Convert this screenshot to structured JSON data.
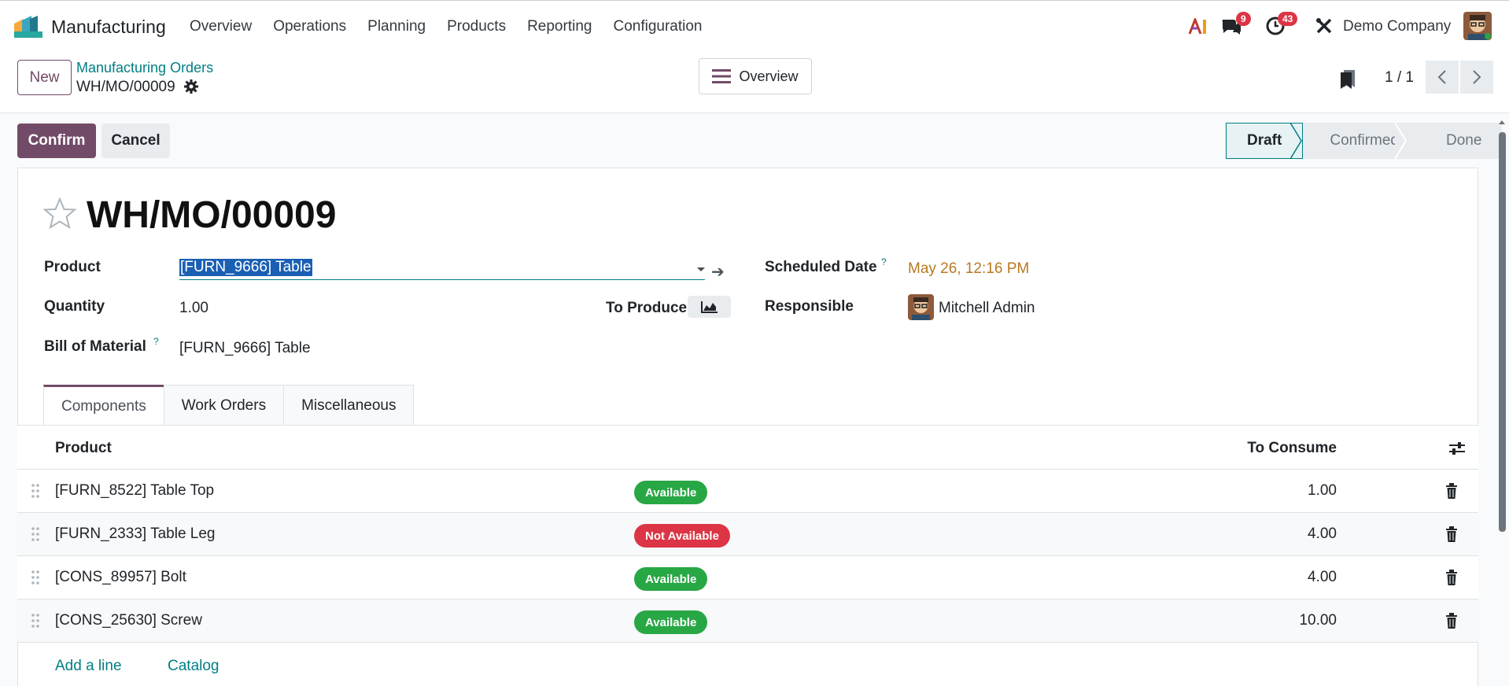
{
  "navbar": {
    "app_name": "Manufacturing",
    "menu": [
      "Overview",
      "Operations",
      "Planning",
      "Products",
      "Reporting",
      "Configuration"
    ],
    "messages_count": "9",
    "activities_count": "43",
    "company": "Demo Company"
  },
  "control": {
    "new_label": "New",
    "breadcrumb_parent": "Manufacturing Orders",
    "breadcrumb_current": "WH/MO/00009",
    "overview_label": "Overview",
    "pager": "1 / 1"
  },
  "actions": {
    "confirm_label": "Confirm",
    "cancel_label": "Cancel"
  },
  "status": {
    "stages": [
      "Draft",
      "Confirmed",
      "Done"
    ],
    "active": "Draft"
  },
  "form": {
    "title": "WH/MO/00009",
    "product_label": "Product",
    "product_value": "[FURN_9666] Table",
    "quantity_label": "Quantity",
    "quantity_value": "1.00",
    "to_produce_label": "To Produce",
    "bom_label": "Bill of Material",
    "bom_value": "[FURN_9666] Table",
    "scheduled_label": "Scheduled Date",
    "scheduled_value": "May 26, 12:16 PM",
    "responsible_label": "Responsible",
    "responsible_value": "Mitchell Admin",
    "help_mark": "?"
  },
  "tabs": [
    "Components",
    "Work Orders",
    "Miscellaneous"
  ],
  "table": {
    "col_product": "Product",
    "col_consume": "To Consume",
    "rows": [
      {
        "product": "[FURN_8522] Table Top",
        "status": "Available",
        "qty": "1.00"
      },
      {
        "product": "[FURN_2333] Table Leg",
        "status": "Not Available",
        "qty": "4.00"
      },
      {
        "product": "[CONS_89957] Bolt",
        "status": "Available",
        "qty": "4.00"
      },
      {
        "product": "[CONS_25630] Screw",
        "status": "Available",
        "qty": "10.00"
      }
    ],
    "add_line": "Add a line",
    "catalog": "Catalog"
  },
  "colors": {
    "brand": "#714b67",
    "link": "#017e84",
    "available": "#28a745",
    "not_available": "#dc3545",
    "date_warning": "#b7791f"
  }
}
